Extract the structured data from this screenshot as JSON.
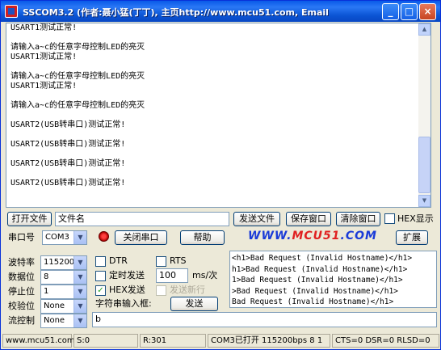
{
  "titlebar": {
    "title": "SSCOM3.2 (作者:聂小猛(丁丁), 主页http://www.mcu51.com, Email: ...",
    "minimize": "_",
    "maximize": "□",
    "close": "×"
  },
  "output": {
    "lines": [
      "USART1测试正常!",
      "",
      "请输入a~c的任意字母控制LED的亮灭",
      "USART1测试正常!",
      "",
      "请输入a~c的任意字母控制LED的亮灭",
      "USART1测试正常!",
      "",
      "请输入a~c的任意字母控制LED的亮灭",
      "",
      "USART2(USB转串口)测试正常!",
      "",
      "USART2(USB转串口)测试正常!",
      "",
      "USART2(USB转串口)测试正常!",
      "",
      "USART2(USB转串口)测试正常!"
    ]
  },
  "file_row": {
    "open_file": "打开文件",
    "filename": "文件名",
    "send_file": "发送文件",
    "save_window": "保存窗口",
    "clear_window": "清除窗口",
    "hex_display": "HEX显示"
  },
  "port_row": {
    "port_label": "串口号",
    "port_value": "COM3",
    "close_port": "关闭串口",
    "help": "帮助",
    "logo_left": "WWW.",
    "logo_mid": "MCU51",
    "logo_right": ".COM",
    "expand": "扩展"
  },
  "settings": {
    "baud_label": "波特率",
    "baud_value": "115200",
    "data_label": "数据位",
    "data_value": "8",
    "stop_label": "停止位",
    "stop_value": "1",
    "parity_label": "校验位",
    "parity_value": "None",
    "flow_label": "流控制",
    "flow_value": "None"
  },
  "options": {
    "dtr": "DTR",
    "rts": "RTS",
    "timed_send": "定时发送",
    "interval": "100",
    "interval_unit": "ms/次",
    "hex_send": "HEX发送",
    "send_newline": "发送新行",
    "input_label": "字符串输入框:",
    "send": "发送",
    "input_value": "b"
  },
  "send_area": {
    "lines": [
      "<h1>Bad Request (Invalid Hostname)</h1>",
      "h1>Bad Request (Invalid Hostname)</h1>",
      "1>Bad Request (Invalid Hostname)</h1>",
      ">Bad Request (Invalid Hostname)</h1>",
      "Bad Request (Invalid Hostname)</h1>"
    ]
  },
  "status": {
    "website": "www.mcu51.com",
    "sent": "S:0",
    "received": "R:301",
    "port_status": "COM3已打开  115200bps 8 1",
    "signals": "CTS=0 DSR=0 RLSD=0"
  },
  "colors": {
    "titlebar": "#0a5ae8",
    "logo_blue": "#1a3bd8",
    "logo_red": "#e02020"
  }
}
